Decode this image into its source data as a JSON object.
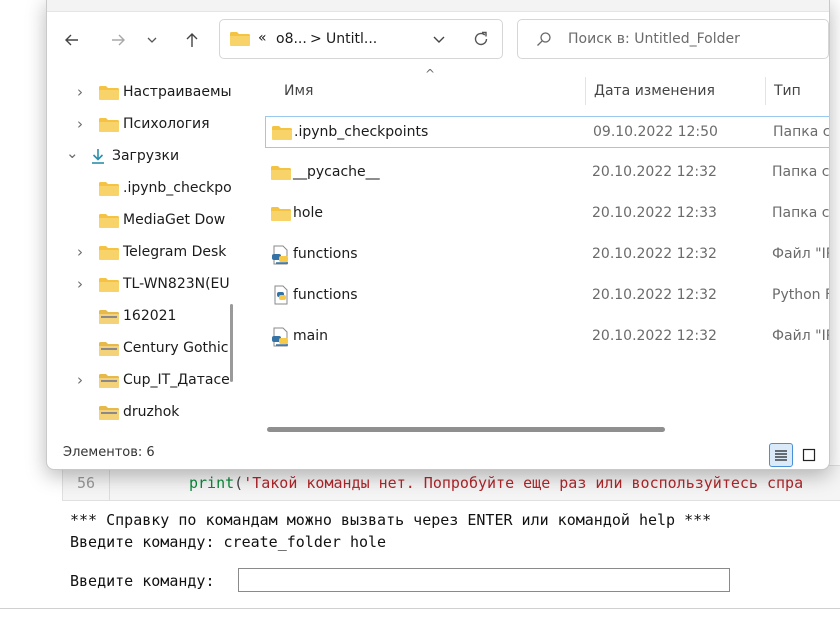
{
  "notebook": {
    "line_number": "56",
    "code": {
      "keyword": "print",
      "open_paren": "(",
      "string": "'Такой команды нет. Попробуйте еще раз или воспользуйтесь спра"
    },
    "output_1": "*** Справку по командам можно вызвать через ENTER или командой help ***",
    "output_2": "Введите команду: create_folder hole",
    "prompt": "Введите команду:",
    "input_value": ""
  },
  "address": {
    "overflow": "«",
    "crumb_1": "o8...",
    "separator": ">",
    "crumb_2": "Untitl..."
  },
  "search": {
    "placeholder": "Поиск в: Untitled_Folder"
  },
  "nav": {
    "items": [
      {
        "label": "Настраиваемы",
        "type": "folder",
        "expander": "›"
      },
      {
        "label": "Психология",
        "type": "folder",
        "expander": "›"
      },
      {
        "label": "Загрузки",
        "type": "downloads",
        "expander": "⌄"
      },
      {
        "label": ".ipynb_checkpo",
        "type": "folder",
        "expander": ""
      },
      {
        "label": "MediaGet Dow",
        "type": "folder",
        "expander": ""
      },
      {
        "label": "Telegram Desk",
        "type": "folder",
        "expander": "›"
      },
      {
        "label": "TL-WN823N(EU",
        "type": "folder",
        "expander": "›"
      },
      {
        "label": "162021",
        "type": "zip",
        "expander": ""
      },
      {
        "label": "Century Gothic",
        "type": "zip",
        "expander": ""
      },
      {
        "label": "Cup_IT_Датасет",
        "type": "zip",
        "expander": "›"
      },
      {
        "label": "druzhok",
        "type": "zip",
        "expander": ""
      }
    ]
  },
  "columns": {
    "name": "Имя",
    "date": "Дата изменения",
    "type": "Тип",
    "sort_indicator": "^"
  },
  "files": [
    {
      "name": ".ipynb_checkpoints",
      "date": "09.10.2022 12:50",
      "type": "Папка с",
      "icon": "folder-icon",
      "selected": true
    },
    {
      "name": "__pycache__",
      "date": "20.10.2022 12:32",
      "type": "Папка с",
      "icon": "folder-icon",
      "selected": false
    },
    {
      "name": "hole",
      "date": "20.10.2022 12:33",
      "type": "Папка с",
      "icon": "folder-icon",
      "selected": false
    },
    {
      "name": "functions",
      "date": "20.10.2022 12:32",
      "type": "Файл \"IP",
      "icon": "python-notebook-icon",
      "selected": false
    },
    {
      "name": "functions",
      "date": "20.10.2022 12:32",
      "type": "Python F",
      "icon": "python-file-icon",
      "selected": false
    },
    {
      "name": "main",
      "date": "20.10.2022 12:32",
      "type": "Файл \"IP",
      "icon": "python-notebook-icon",
      "selected": false
    }
  ],
  "status": {
    "items_count": "Элементов: 6"
  },
  "colors": {
    "folder": "#f5c342",
    "folder_dark": "#e0a91f",
    "accent": "#4a90d9",
    "keyword": "#0b8a3a",
    "string": "#b2262b"
  }
}
